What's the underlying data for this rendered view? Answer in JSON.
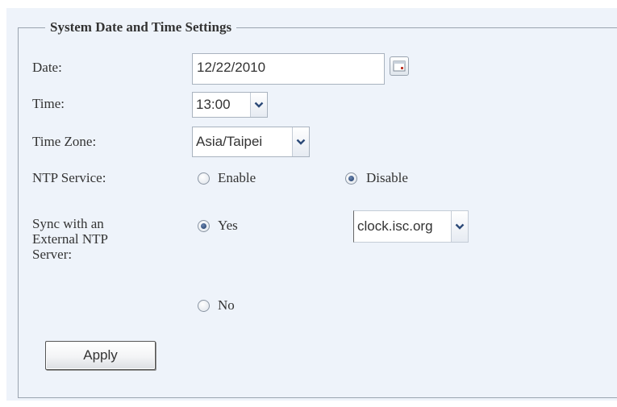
{
  "section": {
    "title": "System Date and Time Settings"
  },
  "date": {
    "label": "Date:",
    "value": "12/22/2010"
  },
  "time": {
    "label": "Time:",
    "value": "13:00"
  },
  "timezone": {
    "label": "Time Zone:",
    "value": "Asia/Taipei"
  },
  "ntp_service": {
    "label": "NTP Service:",
    "options": [
      "Enable",
      "Disable"
    ],
    "selected": "Disable"
  },
  "sync": {
    "label": "Sync with an External NTP Server:",
    "options": [
      "Yes",
      "No"
    ],
    "selected": "Yes",
    "server": "clock.isc.org"
  },
  "actions": {
    "apply_label": "Apply"
  },
  "colors": {
    "panel_bg": "#eef3fa",
    "border": "#9aa4b0",
    "text": "#333333",
    "radio_dot": "#1f3a66"
  },
  "icons": {
    "calendar": "calendar-icon",
    "dropdown": "chevron-down-icon"
  }
}
